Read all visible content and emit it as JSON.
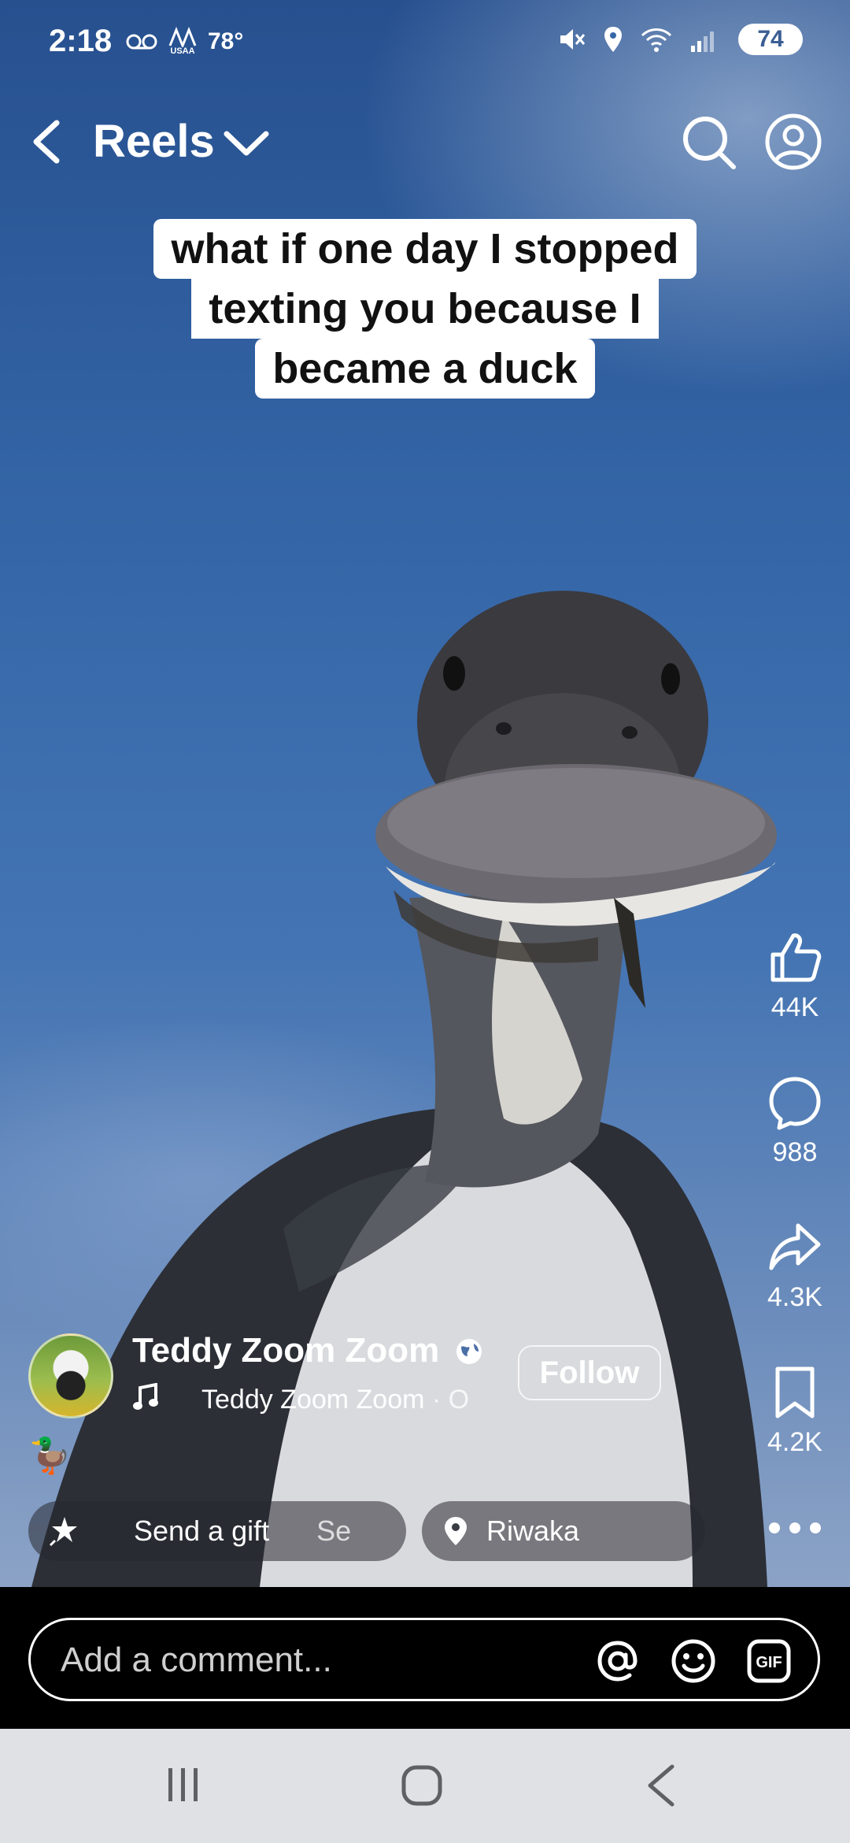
{
  "status_bar": {
    "time": "2:18",
    "temperature": "78°",
    "brand_small": "USAA",
    "battery": "74"
  },
  "header": {
    "title": "Reels"
  },
  "video": {
    "caption_lines": [
      "what if one day I stopped",
      "texting you because I",
      "became a duck"
    ]
  },
  "actions": {
    "likes": "44K",
    "comments": "988",
    "shares": "4.3K",
    "saves": "4.2K"
  },
  "author": {
    "name": "Teddy Zoom Zoom",
    "audio": "Teddy Zoom Zoom",
    "audio_suffix": " · O",
    "follow_label": "Follow",
    "emoji": "🦆"
  },
  "chips": {
    "gift_label": "Send a gift",
    "gift_overflow": "Se",
    "location": "Riwaka"
  },
  "comment": {
    "placeholder": "Add a comment..."
  },
  "icons": {
    "back": "chevron-left-icon",
    "dropdown": "chevron-down-icon",
    "search": "search-icon",
    "profile": "profile-icon",
    "like": "thumbs-up-icon",
    "comment": "comment-bubble-icon",
    "share": "share-arrow-icon",
    "save": "bookmark-icon",
    "more": "more-dots-icon"
  },
  "colors": {
    "sky": "#3567a8",
    "nav_bar": "#e0e1e5"
  }
}
